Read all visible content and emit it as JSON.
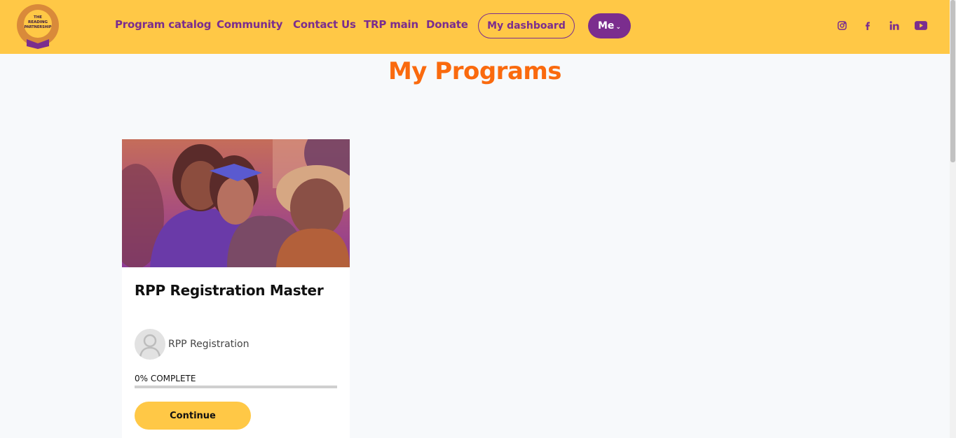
{
  "brand": {
    "logo_text": "THE READING PARTNERSHIP"
  },
  "nav": {
    "links": [
      "Program catalog",
      "Community",
      "Contact Us",
      "TRP main",
      "Donate"
    ],
    "dashboard_label": "My dashboard",
    "me_label": "Me"
  },
  "social": [
    "instagram-icon",
    "facebook-icon",
    "linkedin-icon",
    "youtube-icon"
  ],
  "page": {
    "title": "My Programs"
  },
  "program": {
    "title": "RPP Registration Master",
    "author": "RPP Registration",
    "progress_percent": 0,
    "progress_label": "0% COMPLETE",
    "continue_label": "Continue"
  },
  "colors": {
    "header": "#ffc846",
    "accent_purple": "#7b2d8e",
    "title_orange": "#fa6a0e"
  }
}
